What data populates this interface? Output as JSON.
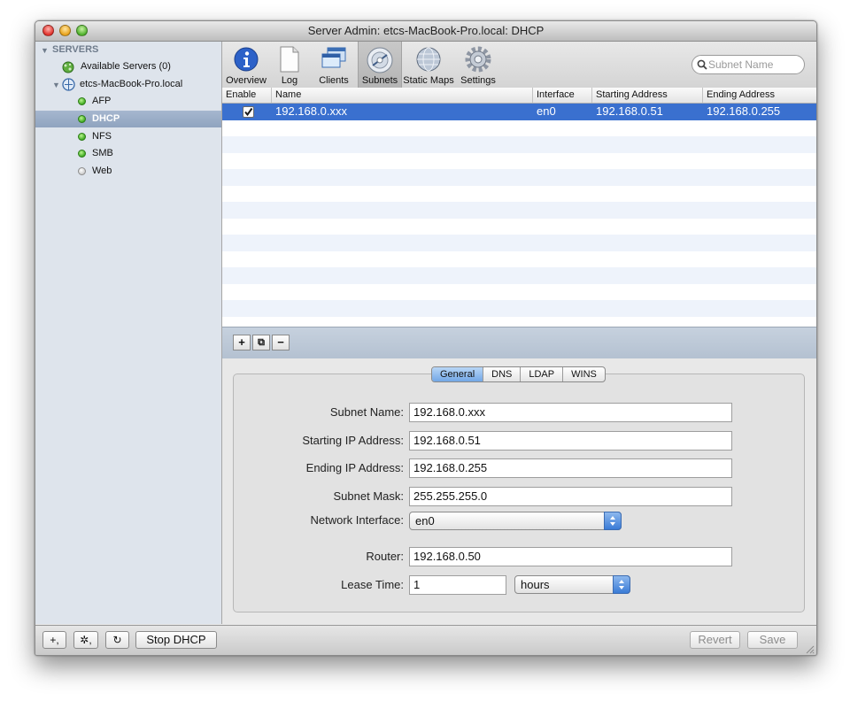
{
  "window": {
    "title": "Server Admin: etcs-MacBook-Pro.local: DHCP"
  },
  "sidebar": {
    "header": "SERVERS",
    "available_servers": "Available Servers (0)",
    "server_name": "etcs-MacBook-Pro.local",
    "services": [
      {
        "label": "AFP",
        "status": "green"
      },
      {
        "label": "DHCP",
        "status": "green"
      },
      {
        "label": "NFS",
        "status": "green"
      },
      {
        "label": "SMB",
        "status": "green"
      },
      {
        "label": "Web",
        "status": "gray"
      }
    ]
  },
  "toolbar": {
    "items": [
      {
        "label": "Overview",
        "icon": "info-icon"
      },
      {
        "label": "Log",
        "icon": "document-icon"
      },
      {
        "label": "Clients",
        "icon": "windows-icon"
      },
      {
        "label": "Subnets",
        "icon": "network-disc-icon"
      },
      {
        "label": "Static Maps",
        "icon": "globe-icon"
      },
      {
        "label": "Settings",
        "icon": "gear-icon"
      }
    ],
    "selected": "Subnets",
    "search_placeholder": "Subnet Name"
  },
  "table": {
    "columns": [
      "Enable",
      "Name",
      "Interface",
      "Starting Address",
      "Ending Address"
    ],
    "rows": [
      {
        "enabled": true,
        "name": "192.168.0.xxx",
        "interface": "en0",
        "start": "192.168.0.51",
        "end": "192.168.0.255"
      }
    ]
  },
  "table_buttons": {
    "add": "+",
    "duplicate": "⧉",
    "remove": "−"
  },
  "detail": {
    "tabs": [
      "General",
      "DNS",
      "LDAP",
      "WINS"
    ],
    "active_tab": "General",
    "fields": {
      "subnet_name_label": "Subnet Name:",
      "subnet_name": "192.168.0.xxx",
      "start_label": "Starting IP Address:",
      "start": "192.168.0.51",
      "end_label": "Ending IP Address:",
      "end": "192.168.0.255",
      "mask_label": "Subnet Mask:",
      "mask": "255.255.255.0",
      "iface_label": "Network Interface:",
      "iface": "en0",
      "router_label": "Router:",
      "router": "192.168.0.50",
      "lease_label": "Lease Time:",
      "lease_value": "1",
      "lease_unit": "hours"
    }
  },
  "bottombar": {
    "add": "+,",
    "action": "✲,",
    "refresh": "↻",
    "stop": "Stop DHCP",
    "revert": "Revert",
    "save": "Save"
  },
  "colors": {
    "selection": "#3a70cf",
    "sidebar": "#dee4ec",
    "status_on": "#38a51c"
  }
}
